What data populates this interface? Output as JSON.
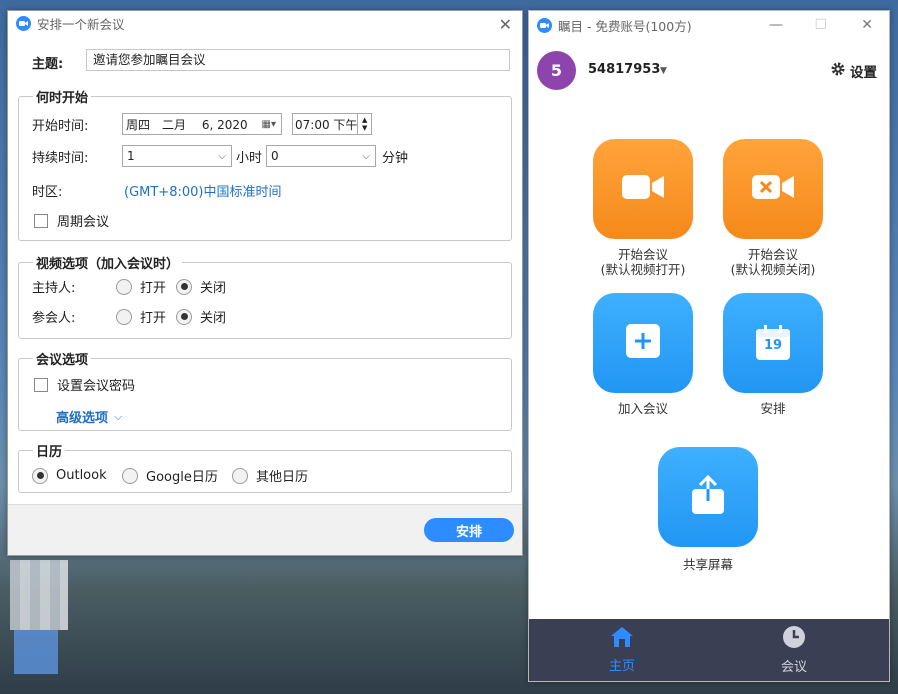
{
  "scheduler": {
    "title": "安排一个新会议",
    "topic_label": "主题:",
    "topic_value": "邀请您参加瞩目会议",
    "when_legend": "何时开始",
    "start_label": "开始时间:",
    "start_date": "周四　二月　 6, 2020",
    "start_time": "07:00 下午",
    "duration_label": "持续时间:",
    "duration_hours": "1",
    "hours_unit": "小时",
    "duration_minutes": "0",
    "minutes_unit": "分钟",
    "timezone_label": "时区:",
    "timezone_value": "(GMT+8:00)中国标准时间",
    "recurring_label": "周期会议",
    "video_legend": "视频选项（加入会议时）",
    "host_label": "主持人:",
    "participant_label": "参会人:",
    "on_label": "打开",
    "off_label": "关闭",
    "meeting_legend": "会议选项",
    "password_label": "设置会议密码",
    "advanced_label": "高级选项",
    "calendar_legend": "日历",
    "cal_outlook": "Outlook",
    "cal_google": "Google日历",
    "cal_other": "其他日历",
    "schedule_button": "安排"
  },
  "zoom": {
    "title": "瞩目 - 免费账号(100方)",
    "avatar_letter": "5",
    "account_id": "54817953",
    "settings_label": "设置",
    "tiles": {
      "start_video_on_line1": "开始会议",
      "start_video_on_line2": "(默认视频打开)",
      "start_video_off_line1": "开始会议",
      "start_video_off_line2": "(默认视频关闭)",
      "join": "加入会议",
      "schedule": "安排",
      "schedule_day": "19",
      "share": "共享屏幕"
    },
    "nav": {
      "home": "主页",
      "meetings": "会议"
    }
  },
  "colors": {
    "accent_blue": "#2d8cff",
    "orange": "#f6891a",
    "nav_bg": "#3b3f54",
    "avatar": "#8e44ad"
  }
}
